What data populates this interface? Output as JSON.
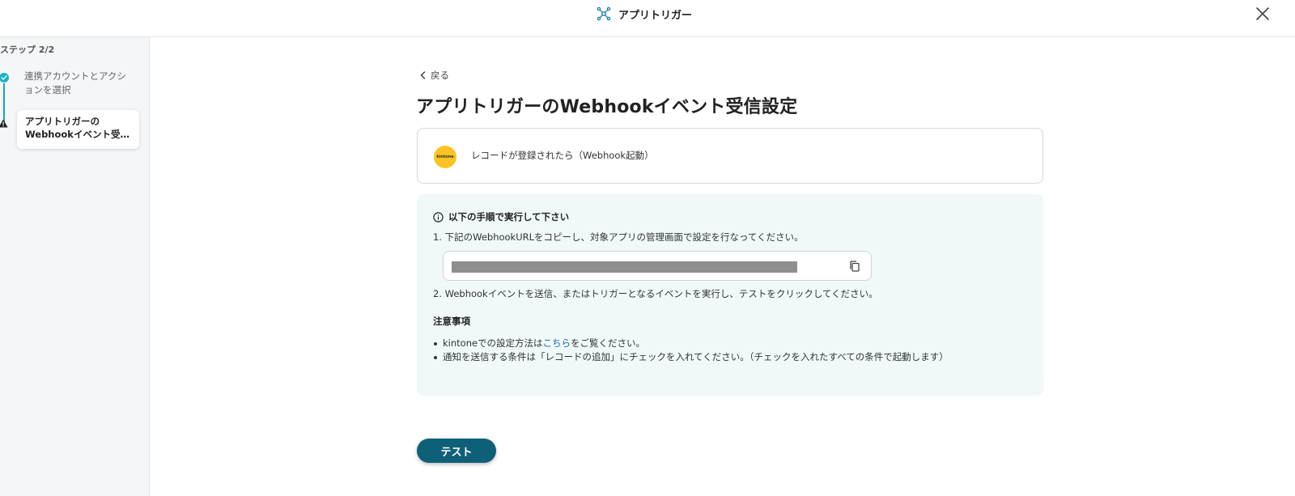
{
  "header": {
    "app_title": "アプリトリガー",
    "close_icon": "close-icon"
  },
  "sidebar": {
    "step_title": "ステップ 2/2",
    "steps": [
      {
        "label": "連携アカウントとアクションを選択",
        "status": "completed"
      },
      {
        "label_line1": "アプリトリガーの",
        "label_line2": "Webhookイベント受信設定",
        "status": "current"
      }
    ]
  },
  "main": {
    "back_label": "戻る",
    "title": "アプリトリガーのWebhookイベント受信設定",
    "trigger": {
      "app": "kintone",
      "label": "レコードが登録されたら（Webhook起動）"
    },
    "instructions": {
      "heading": "以下の手順で実行して下さい",
      "step1": "1. 下記のWebhookURLをコピーし、対象アプリの管理画面で設定を行なってください。",
      "step2": "2. Webhookイベントを送信、またはトリガーとなるイベントを実行し、テストをクリックしてください。",
      "notes_title": "注意事項",
      "note1_prefix": "kintoneでの設定方法は",
      "note1_link": "こちら",
      "note1_suffix": "をご覧ください。",
      "note2": "通知を送信する条件は「レコードの追加」にチェックを入れてください。（チェックを入れたすべての条件で起動します）"
    },
    "test_button": "テスト"
  },
  "colors": {
    "accent": "#0f5f78",
    "step_done": "#21b2c4",
    "info_bg": "#f0f8f8",
    "kintone_yellow": "#fdc326",
    "link": "#1a6aa8"
  }
}
